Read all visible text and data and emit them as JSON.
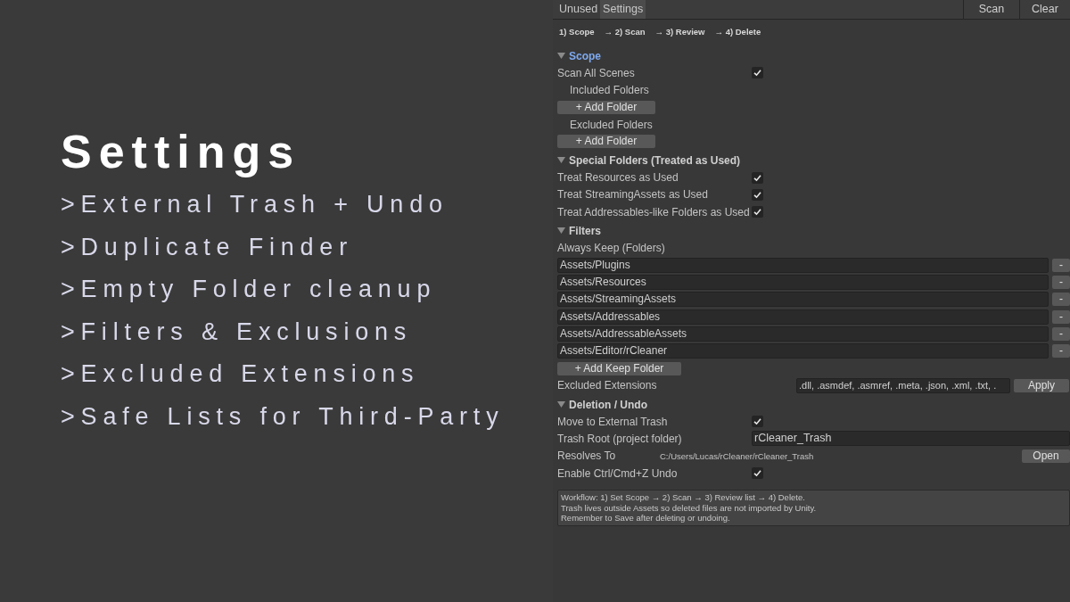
{
  "slide": {
    "title": "Settings",
    "bullets": [
      ">External Trash + Undo",
      ">Duplicate Finder",
      ">Empty Folder cleanup",
      ">Filters & Exclusions",
      ">Excluded Extensions",
      ">Safe Lists for Third-Party"
    ]
  },
  "toolbar": {
    "tabs": [
      {
        "label": "Unused",
        "selected": false
      },
      {
        "label": "Settings",
        "selected": true
      }
    ],
    "buttons": [
      "Scan",
      "Clear"
    ]
  },
  "steps": [
    "1) Scope",
    "→ 2) Scan",
    "→ 3) Review",
    "→ 4) Delete"
  ],
  "sections": [
    {
      "title": "Scope",
      "expanded": true,
      "selected": true,
      "rows": [
        {
          "kind": "checkbox",
          "label": "Scan All Scenes",
          "checked": true
        },
        {
          "kind": "sublabel",
          "label": "Included Folders"
        },
        {
          "kind": "button",
          "label": "+ Add Folder"
        },
        {
          "kind": "sublabel",
          "label": "Excluded Folders"
        },
        {
          "kind": "button",
          "label": "+ Add Folder"
        }
      ]
    },
    {
      "title": "Special Folders (Treated as Used)",
      "expanded": true,
      "selected": false,
      "rows": [
        {
          "kind": "checkbox",
          "label": "Treat Resources as Used",
          "checked": true
        },
        {
          "kind": "checkbox",
          "label": "Treat StreamingAssets as Used",
          "checked": true
        },
        {
          "kind": "checkbox",
          "label": "Treat Addressables-like Folders as Used",
          "checked": true
        }
      ]
    },
    {
      "title": "Filters",
      "expanded": true,
      "selected": false,
      "rows": [
        {
          "kind": "label",
          "label": "Always Keep (Folders)"
        },
        {
          "kind": "list_item",
          "value": "Assets/Plugins",
          "button": "-"
        },
        {
          "kind": "list_item",
          "value": "Assets/Resources",
          "button": "-"
        },
        {
          "kind": "list_item",
          "value": "Assets/StreamingAssets",
          "button": "-"
        },
        {
          "kind": "list_item",
          "value": "Assets/Addressables",
          "button": "-"
        },
        {
          "kind": "list_item",
          "value": "Assets/AddressableAssets",
          "button": "-"
        },
        {
          "kind": "list_item",
          "value": "Assets/Editor/rCleaner",
          "button": "-"
        },
        {
          "kind": "wide_button",
          "label": "+ Add Keep Folder"
        },
        {
          "kind": "field_button",
          "label": "Excluded Extensions",
          "value": ".dll, .asmdef, .asmref, .meta, .json, .xml, .txt, .",
          "button": "Apply"
        }
      ]
    },
    {
      "title": "Deletion / Undo",
      "expanded": true,
      "selected": false,
      "rows": [
        {
          "kind": "checkbox",
          "label": "Move to External Trash",
          "checked": true
        },
        {
          "kind": "text_field",
          "label": "Trash Root (project folder)",
          "value": "rCleaner_Trash"
        },
        {
          "kind": "path",
          "label": "Resolves To",
          "value": "C:/Users/Lucas/rCleaner/rCleaner_Trash",
          "button": "Open"
        },
        {
          "kind": "checkbox",
          "label": "Enable Ctrl/Cmd+Z Undo",
          "checked": true
        }
      ]
    }
  ],
  "help_box": [
    "Workflow: 1) Set Scope → 2) Scan → 3) Review list → 4) Delete.",
    "Trash lives outside Assets so deleted files are not imported by Unity.",
    "Remember to Save after deleting or undoing."
  ]
}
